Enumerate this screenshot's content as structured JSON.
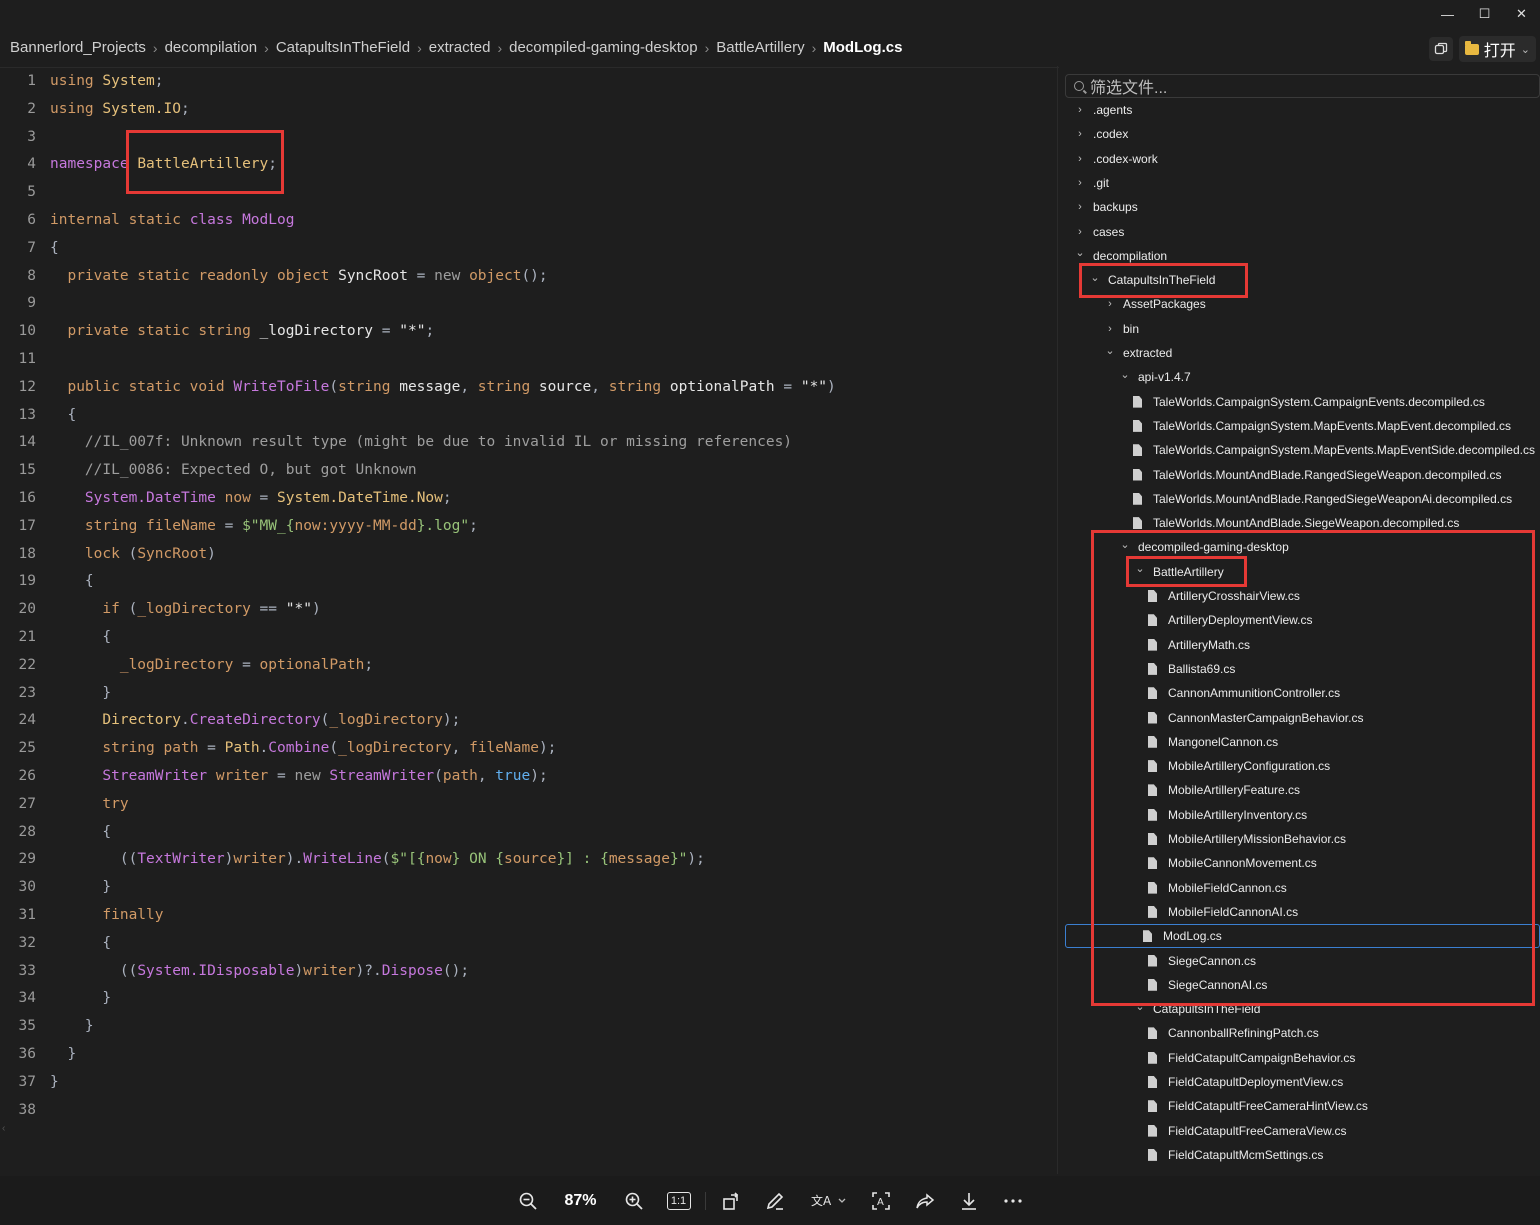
{
  "window": {
    "minimize": "—",
    "maximize": "☐",
    "close": "✕"
  },
  "breadcrumb": [
    "Bannerlord_Projects",
    "decompilation",
    "CatapultsInTheField",
    "extracted",
    "decompiled-gaming-desktop",
    "BattleArtillery",
    "ModLog.cs"
  ],
  "header": {
    "open_label": "打开"
  },
  "editor": {
    "line_numbers": [
      "1",
      "2",
      "3",
      "4",
      "5",
      "6",
      "7",
      "8",
      "9",
      "10",
      "11",
      "12",
      "13",
      "14",
      "15",
      "16",
      "17",
      "18",
      "19",
      "20",
      "21",
      "22",
      "23",
      "24",
      "25",
      "26",
      "27",
      "28",
      "29",
      "30",
      "31",
      "32",
      "33",
      "34",
      "35",
      "36",
      "37",
      "38"
    ]
  },
  "sidebar": {
    "filter_placeholder": "筛选文件...",
    "tree": [
      {
        "label": ".agents",
        "type": "folder",
        "open": false
      },
      {
        "label": ".codex",
        "type": "folder",
        "open": false
      },
      {
        "label": ".codex-work",
        "type": "folder",
        "open": false
      },
      {
        "label": ".git",
        "type": "folder",
        "open": false
      },
      {
        "label": "backups",
        "type": "folder",
        "open": false
      },
      {
        "label": "cases",
        "type": "folder",
        "open": false
      },
      {
        "label": "decompilation",
        "type": "folder",
        "open": true
      },
      {
        "label": "CatapultsInTheField",
        "type": "folder",
        "open": true
      },
      {
        "label": "AssetPackages",
        "type": "folder",
        "open": false
      },
      {
        "label": "bin",
        "type": "folder",
        "open": false
      },
      {
        "label": "extracted",
        "type": "folder",
        "open": true
      },
      {
        "label": "api-v1.4.7",
        "type": "folder",
        "open": true
      },
      {
        "label": "TaleWorlds.CampaignSystem.CampaignEvents.decompiled.cs",
        "type": "file"
      },
      {
        "label": "TaleWorlds.CampaignSystem.MapEvents.MapEvent.decompiled.cs",
        "type": "file"
      },
      {
        "label": "TaleWorlds.CampaignSystem.MapEvents.MapEventSide.decompiled.cs",
        "type": "file"
      },
      {
        "label": "TaleWorlds.MountAndBlade.RangedSiegeWeapon.decompiled.cs",
        "type": "file"
      },
      {
        "label": "TaleWorlds.MountAndBlade.RangedSiegeWeaponAi.decompiled.cs",
        "type": "file"
      },
      {
        "label": "TaleWorlds.MountAndBlade.SiegeWeapon.decompiled.cs",
        "type": "file"
      },
      {
        "label": "decompiled-gaming-desktop",
        "type": "folder",
        "open": true
      },
      {
        "label": "BattleArtillery",
        "type": "folder",
        "open": true
      },
      {
        "label": "ArtilleryCrosshairView.cs",
        "type": "file"
      },
      {
        "label": "ArtilleryDeploymentView.cs",
        "type": "file"
      },
      {
        "label": "ArtilleryMath.cs",
        "type": "file"
      },
      {
        "label": "Ballista69.cs",
        "type": "file"
      },
      {
        "label": "CannonAmmunitionController.cs",
        "type": "file"
      },
      {
        "label": "CannonMasterCampaignBehavior.cs",
        "type": "file"
      },
      {
        "label": "MangonelCannon.cs",
        "type": "file"
      },
      {
        "label": "MobileArtilleryConfiguration.cs",
        "type": "file"
      },
      {
        "label": "MobileArtilleryFeature.cs",
        "type": "file"
      },
      {
        "label": "MobileArtilleryInventory.cs",
        "type": "file"
      },
      {
        "label": "MobileArtilleryMissionBehavior.cs",
        "type": "file"
      },
      {
        "label": "MobileCannonMovement.cs",
        "type": "file"
      },
      {
        "label": "MobileFieldCannon.cs",
        "type": "file"
      },
      {
        "label": "MobileFieldCannonAI.cs",
        "type": "file"
      },
      {
        "label": "ModLog.cs",
        "type": "file",
        "selected": true
      },
      {
        "label": "SiegeCannon.cs",
        "type": "file"
      },
      {
        "label": "SiegeCannonAI.cs",
        "type": "file"
      },
      {
        "label": "CatapultsInTheField",
        "type": "folder",
        "open": true
      },
      {
        "label": "CannonballRefiningPatch.cs",
        "type": "file"
      },
      {
        "label": "FieldCatapultCampaignBehavior.cs",
        "type": "file"
      },
      {
        "label": "FieldCatapultDeploymentView.cs",
        "type": "file"
      },
      {
        "label": "FieldCatapultFreeCameraHintView.cs",
        "type": "file"
      },
      {
        "label": "FieldCatapultFreeCameraView.cs",
        "type": "file"
      },
      {
        "label": "FieldCatapultMcmSettings.cs",
        "type": "file"
      }
    ]
  },
  "toolbar": {
    "zoom_level": "87%",
    "actual_size": "1:1"
  },
  "colors": {
    "highlight_box": "#e53935",
    "selection_border": "#3b7fd1"
  }
}
